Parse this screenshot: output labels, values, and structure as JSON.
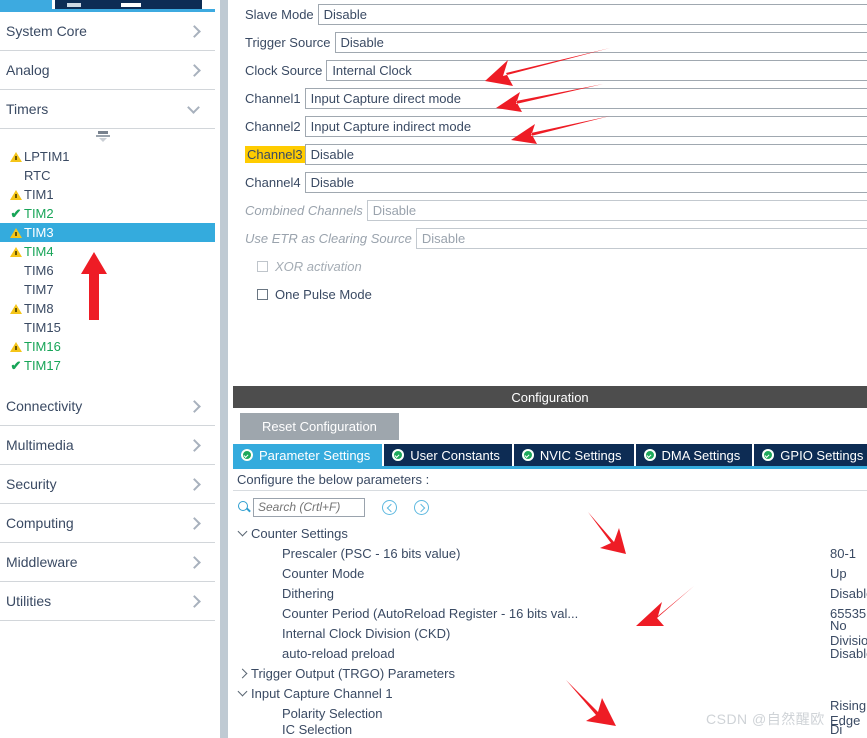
{
  "sidebar": {
    "categories_top": [
      {
        "label": "System Core",
        "expanded": false
      },
      {
        "label": "Analog",
        "expanded": false
      },
      {
        "label": "Timers",
        "expanded": true
      }
    ],
    "timers": [
      {
        "name": "LPTIM1",
        "status": "warning",
        "configured": false
      },
      {
        "name": "RTC",
        "status": "none",
        "configured": false
      },
      {
        "name": "TIM1",
        "status": "warning",
        "configured": false
      },
      {
        "name": "TIM2",
        "status": "ok",
        "configured": true
      },
      {
        "name": "TIM3",
        "status": "warning",
        "configured": false,
        "selected": true
      },
      {
        "name": "TIM4",
        "status": "warning",
        "configured": true
      },
      {
        "name": "TIM6",
        "status": "none",
        "configured": false
      },
      {
        "name": "TIM7",
        "status": "none",
        "configured": false
      },
      {
        "name": "TIM8",
        "status": "warning",
        "configured": false
      },
      {
        "name": "TIM15",
        "status": "none",
        "configured": false
      },
      {
        "name": "TIM16",
        "status": "warning",
        "configured": true
      },
      {
        "name": "TIM17",
        "status": "ok",
        "configured": true
      }
    ],
    "categories_bottom": [
      {
        "label": "Connectivity"
      },
      {
        "label": "Multimedia"
      },
      {
        "label": "Security"
      },
      {
        "label": "Computing"
      },
      {
        "label": "Middleware"
      },
      {
        "label": "Utilities"
      }
    ]
  },
  "mode": {
    "rows": [
      {
        "label": "Slave Mode",
        "value": "Disable",
        "dim": false,
        "highlight": false
      },
      {
        "label": "Trigger Source",
        "value": "Disable",
        "dim": false,
        "highlight": false
      },
      {
        "label": "Clock Source",
        "value": "Internal Clock",
        "dim": false,
        "highlight": false
      },
      {
        "label": "Channel1",
        "value": "Input Capture direct mode",
        "dim": false,
        "highlight": false
      },
      {
        "label": "Channel2",
        "value": "Input Capture indirect mode",
        "dim": false,
        "highlight": false
      },
      {
        "label": "Channel3",
        "value": "Disable",
        "dim": false,
        "highlight": true
      },
      {
        "label": "Channel4",
        "value": "Disable",
        "dim": false,
        "highlight": false
      },
      {
        "label": "Combined Channels",
        "value": "Disable",
        "dim": true,
        "highlight": false
      },
      {
        "label": "Use ETR as Clearing Source",
        "value": "Disable",
        "dim": true,
        "highlight": false
      }
    ],
    "checkboxes": [
      {
        "label": "XOR activation",
        "checked": false,
        "dim": true
      },
      {
        "label": "One Pulse Mode",
        "checked": false,
        "dim": false
      }
    ]
  },
  "configuration": {
    "title": "Configuration",
    "reset_label": "Reset Configuration",
    "tabs": [
      {
        "label": "Parameter Settings",
        "active": true
      },
      {
        "label": "User Constants",
        "active": false
      },
      {
        "label": "NVIC Settings",
        "active": false
      },
      {
        "label": "DMA Settings",
        "active": false
      },
      {
        "label": "GPIO Settings",
        "active": false
      }
    ],
    "subtitle": "Configure the below parameters :",
    "search_placeholder": "Search (Crtl+F)",
    "search_value": "",
    "tree": [
      {
        "type": "group",
        "label": "Counter Settings",
        "expanded": true,
        "value": ""
      },
      {
        "type": "param",
        "label": "Prescaler (PSC - 16 bits value)",
        "value": "80-1"
      },
      {
        "type": "param",
        "label": "Counter Mode",
        "value": "Up"
      },
      {
        "type": "param",
        "label": "Dithering",
        "value": "Disable"
      },
      {
        "type": "param",
        "label": "Counter Period (AutoReload Register - 16 bits val...",
        "value": "65535"
      },
      {
        "type": "param",
        "label": "Internal Clock Division (CKD)",
        "value": "No Division"
      },
      {
        "type": "param",
        "label": "auto-reload preload",
        "value": "Disable"
      },
      {
        "type": "group",
        "label": "Trigger Output (TRGO) Parameters",
        "expanded": false,
        "value": ""
      },
      {
        "type": "group",
        "label": "Input Capture Channel 1",
        "expanded": true,
        "value": ""
      },
      {
        "type": "param",
        "label": "Polarity Selection",
        "value": "Rising Edge"
      },
      {
        "type": "param",
        "label": "IC Selection",
        "value": "Di",
        "clipped": true
      }
    ]
  },
  "colors": {
    "accent_blue": "#34abdd",
    "tab_navy": "#0d2c54",
    "warning_yellow": "#f5c518",
    "ok_green": "#18a558",
    "highlight_yellow": "#ffcc00",
    "annotation_red": "#ee1c25",
    "panel_header_grey": "#4d4d4d"
  },
  "watermark": "CSDN @自然醒欧"
}
